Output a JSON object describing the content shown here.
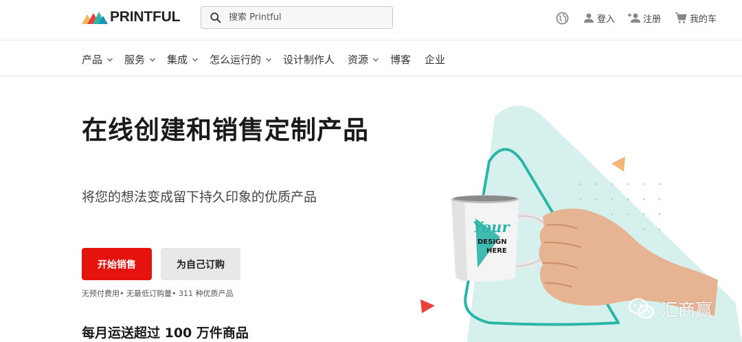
{
  "header": {
    "logo_text": "PRINTFUL",
    "search_placeholder": "搜索 Printful",
    "login_label": "登入",
    "register_label": "注册",
    "cart_label": "我的车"
  },
  "nav": {
    "items": [
      {
        "label": "产品",
        "dropdown": true
      },
      {
        "label": "服务",
        "dropdown": true
      },
      {
        "label": "集成",
        "dropdown": true
      },
      {
        "label": "怎么运行的",
        "dropdown": true
      },
      {
        "label": "设计制作人",
        "dropdown": false
      },
      {
        "label": "资源",
        "dropdown": true
      },
      {
        "label": "博客",
        "dropdown": false
      },
      {
        "label": "企业",
        "dropdown": false
      }
    ]
  },
  "hero": {
    "title": "在线创建和销售定制产品",
    "subtitle": "将您的想法变成留下持久印象的优质产品",
    "primary_button": "开始销售",
    "secondary_button": "为自己订购",
    "note": "无预付费用• 无最低订购量• 311 种优质产品",
    "heading2": "每月运送超过 100 万件商品"
  },
  "mug": {
    "line1": "Your",
    "line2": "DESIGN",
    "line3": "HERE"
  },
  "watermark": {
    "text": "汇商赢"
  },
  "colors": {
    "accent_red": "#e5130e",
    "teal": "#2bb5a7",
    "mint": "#cdeee9",
    "orange": "#f4b77a"
  }
}
